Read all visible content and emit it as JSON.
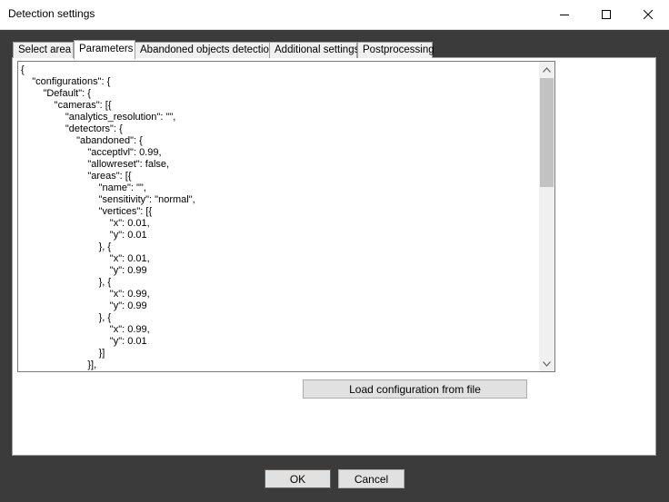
{
  "window": {
    "title": "Detection settings",
    "controls": {
      "minimize": "minimize-icon",
      "maximize": "maximize-icon",
      "close": "close-icon"
    }
  },
  "tabs": [
    {
      "label": "Select area",
      "active": false
    },
    {
      "label": "Parameters",
      "active": true
    },
    {
      "label": "Abandoned objects detection",
      "active": false
    },
    {
      "label": "Additional settings",
      "active": false
    },
    {
      "label": "Postprocessing",
      "active": false
    }
  ],
  "editor": {
    "content": "{\n    \"configurations\": {\n        \"Default\": {\n            \"cameras\": [{\n                \"analytics_resolution\": \"\",\n                \"detectors\": {\n                    \"abandoned\": {\n                        \"acceptlvl\": 0.99,\n                        \"allowreset\": false,\n                        \"areas\": [{\n                            \"name\": \"\",\n                            \"sensitivity\": \"normal\",\n                            \"vertices\": [{\n                                \"x\": 0.01,\n                                \"y\": 0.01\n                            }, {\n                                \"x\": 0.01,\n                                \"y\": 0.99\n                            }, {\n                                \"x\": 0.99,\n                                \"y\": 0.99\n                            }, {\n                                \"x\": 0.99,\n                                \"y\": 0.01\n                            }]\n                        }],"
  },
  "buttons": {
    "load_config": "Load configuration from file",
    "ok": "OK",
    "cancel": "Cancel"
  },
  "colors": {
    "background": "#3b3b3b",
    "panel": "#ffffff",
    "default_button_border": "#0078d7"
  }
}
